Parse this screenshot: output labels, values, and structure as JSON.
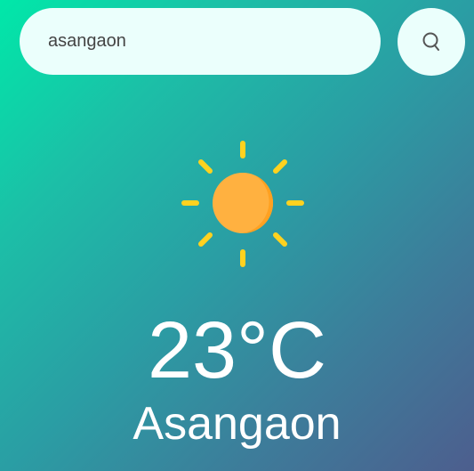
{
  "search": {
    "value": "asangaon",
    "button_icon": "search-icon"
  },
  "weather": {
    "icon": "sun-icon",
    "temperature": "23°C",
    "city": "Asangaon"
  },
  "colors": {
    "gradient_start": "#00e8a9",
    "gradient_end": "#4d5e8e",
    "search_bg": "#ebfffc",
    "sun_core": "#ffb140",
    "sun_rays": "#ffd21f"
  }
}
